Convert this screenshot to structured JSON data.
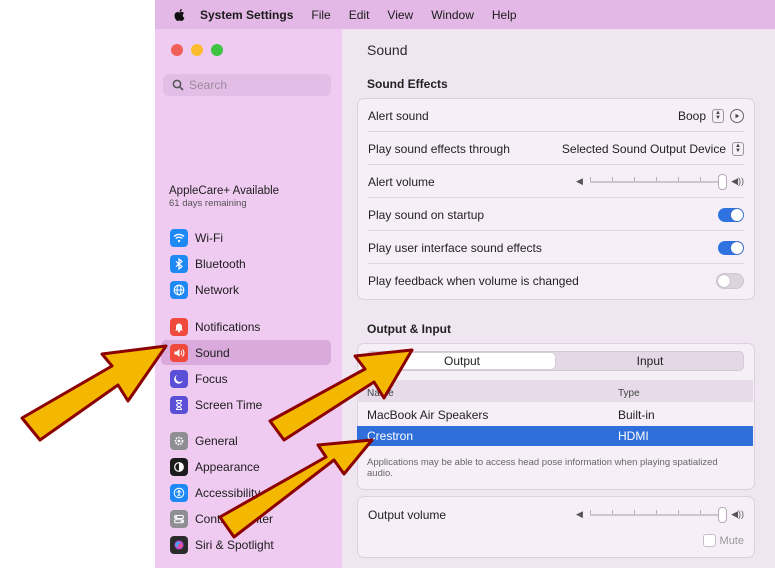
{
  "menubar": {
    "app_name": "System Settings",
    "items": [
      "File",
      "Edit",
      "View",
      "Window",
      "Help"
    ]
  },
  "sidebar": {
    "search_placeholder": "Search",
    "applecare": {
      "title": "AppleCare+ Available",
      "subtitle": "61 days remaining"
    },
    "items": [
      {
        "label": "Wi-Fi",
        "icon": "wifi-icon",
        "color": "#1e88f5"
      },
      {
        "label": "Bluetooth",
        "icon": "bluetooth-icon",
        "color": "#1e88f5"
      },
      {
        "label": "Network",
        "icon": "globe-icon",
        "color": "#1e88f5"
      },
      {
        "label": "Notifications",
        "icon": "bell-icon",
        "color": "#f04a3c"
      },
      {
        "label": "Sound",
        "icon": "speaker-icon",
        "color": "#f04a3c",
        "selected": true
      },
      {
        "label": "Focus",
        "icon": "moon-icon",
        "color": "#5a4fd6"
      },
      {
        "label": "Screen Time",
        "icon": "hourglass-icon",
        "color": "#5a4fd6"
      },
      {
        "label": "General",
        "icon": "gear-icon",
        "color": "#8e8e93"
      },
      {
        "label": "Appearance",
        "icon": "appearance-icon",
        "color": "#1c1c1c"
      },
      {
        "label": "Accessibility",
        "icon": "accessibility-icon",
        "color": "#1e88f5"
      },
      {
        "label": "Control Center",
        "icon": "control-center-icon",
        "color": "#8e8e93"
      },
      {
        "label": "Siri & Spotlight",
        "icon": "siri-icon",
        "color": "#2b2b2b"
      }
    ]
  },
  "main": {
    "title": "Sound",
    "sound_effects": {
      "heading": "Sound Effects",
      "alert_sound_label": "Alert sound",
      "alert_sound_value": "Boop",
      "play_through_label": "Play sound effects through",
      "play_through_value": "Selected Sound Output Device",
      "alert_volume_label": "Alert volume",
      "alert_volume_level": 1.0,
      "startup_label": "Play sound on startup",
      "startup_on": true,
      "ui_effects_label": "Play user interface sound effects",
      "ui_effects_on": true,
      "feedback_label": "Play feedback when volume is changed",
      "feedback_on": false
    },
    "output_input": {
      "heading": "Output & Input",
      "tabs": [
        "Output",
        "Input"
      ],
      "selected_tab": "Output",
      "columns": [
        "Name",
        "Type"
      ],
      "devices": [
        {
          "name": "MacBook Air Speakers",
          "type": "Built-in",
          "selected": false
        },
        {
          "name": "Crestron",
          "type": "HDMI",
          "selected": true
        }
      ],
      "note": "Applications may be able to access head pose information when playing spatialized audio."
    },
    "output_volume": {
      "label": "Output volume",
      "level": 1.0,
      "mute_label": "Mute"
    }
  },
  "colors": {
    "accent": "#2f6fdb",
    "toggle_on": "#2f72e0",
    "annotation_arrow_fill": "#f5b800",
    "annotation_arrow_stroke": "#8b0000"
  }
}
